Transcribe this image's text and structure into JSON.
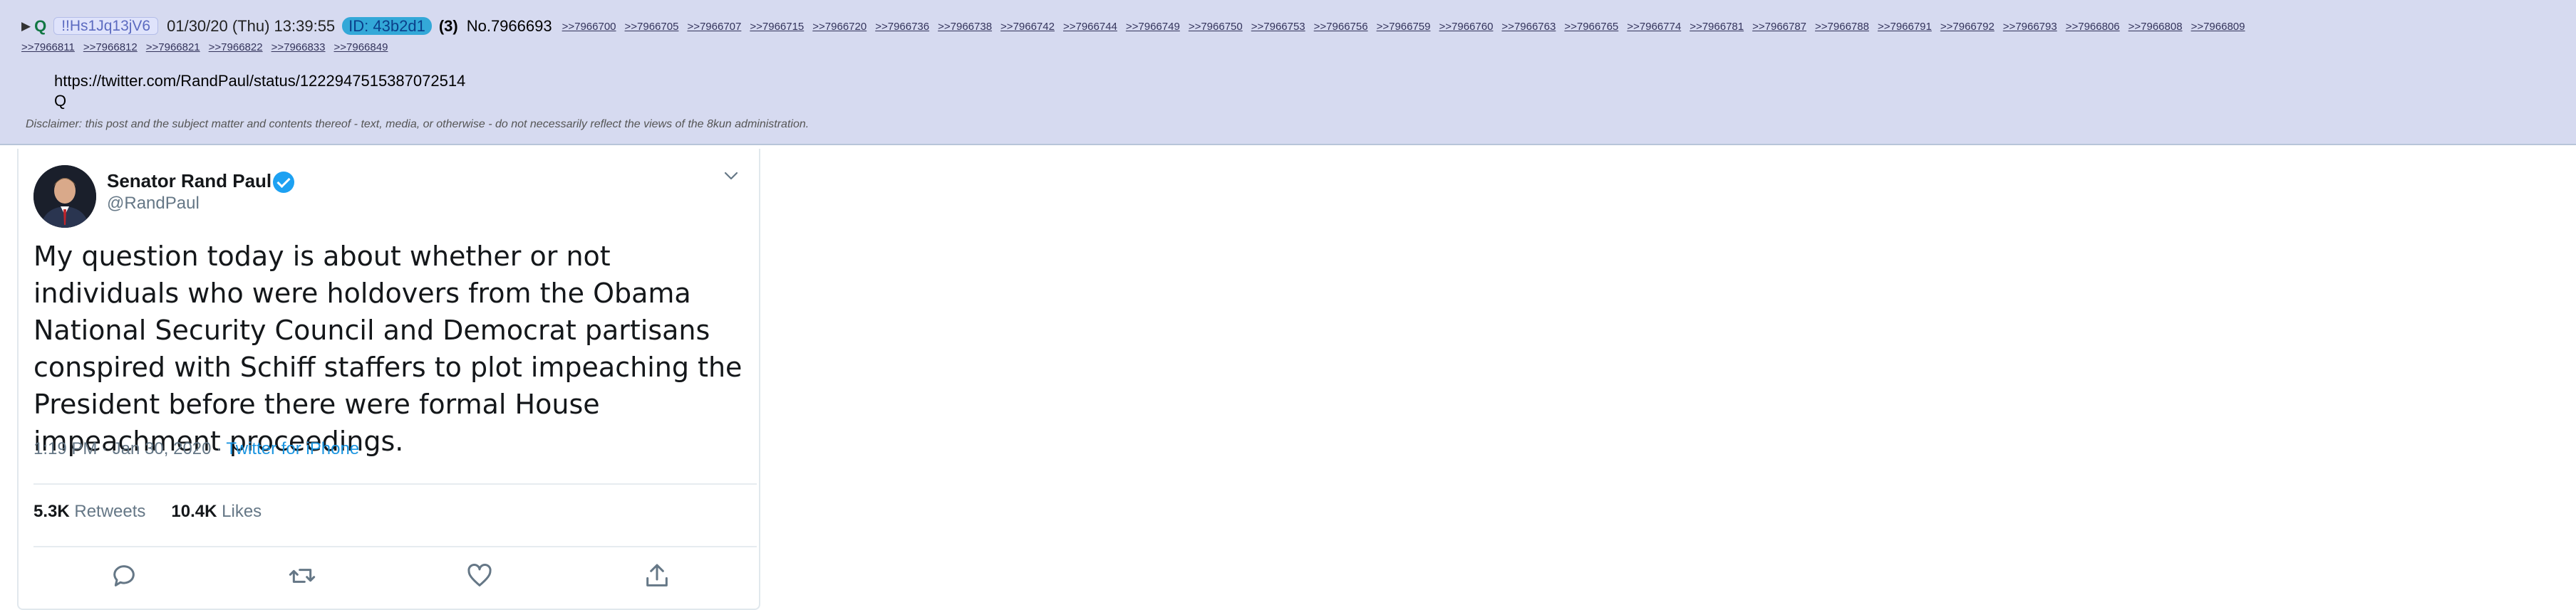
{
  "post": {
    "expand_glyph": "▶",
    "name": "Q",
    "tripcode": "!!Hs1Jq13jV6",
    "datetime": "01/30/20 (Thu) 13:39:55",
    "poster_id": "ID: 43b2d1",
    "count": "(3)",
    "post_number": "No.7966693",
    "replies": [
      ">>7966700",
      ">>7966705",
      ">>7966707",
      ">>7966715",
      ">>7966720",
      ">>7966736",
      ">>7966738",
      ">>7966742",
      ">>7966744",
      ">>7966749",
      ">>7966750",
      ">>7966753",
      ">>7966756",
      ">>7966759",
      ">>7966760",
      ">>7966763",
      ">>7966765",
      ">>7966774",
      ">>7966781",
      ">>7966787",
      ">>7966788",
      ">>7966791",
      ">>7966792",
      ">>7966793",
      ">>7966806",
      ">>7966808",
      ">>7966809",
      ">>7966811",
      ">>7966812",
      ">>7966821",
      ">>7966822",
      ">>7966833",
      ">>7966849"
    ],
    "body_url": "https://twitter.com/RandPaul/status/1222947515387072514",
    "body_signature": "Q",
    "disclaimer": "Disclaimer: this post and the subject matter and contents thereof - text, media, or otherwise - do not necessarily reflect the views of the 8kun administration."
  },
  "tweet": {
    "display_name": "Senator Rand Paul",
    "handle": "@RandPaul",
    "text": "My question today is about whether or not individuals who were holdovers from the Obama National Security Council and Democrat partisans conspired with Schiff staffers to plot impeaching the President before there were formal House impeachment proceedings.",
    "time": "1:19 PM · Jan 30, 2020 · ",
    "source": "Twitter for iPhone",
    "retweets_count": "5.3K",
    "retweets_label": "Retweets",
    "likes_count": "10.4K",
    "likes_label": "Likes",
    "colors": {
      "link": "#1b95e0",
      "verified": "#1da1f2",
      "post_bg": "#d6daf0"
    }
  }
}
